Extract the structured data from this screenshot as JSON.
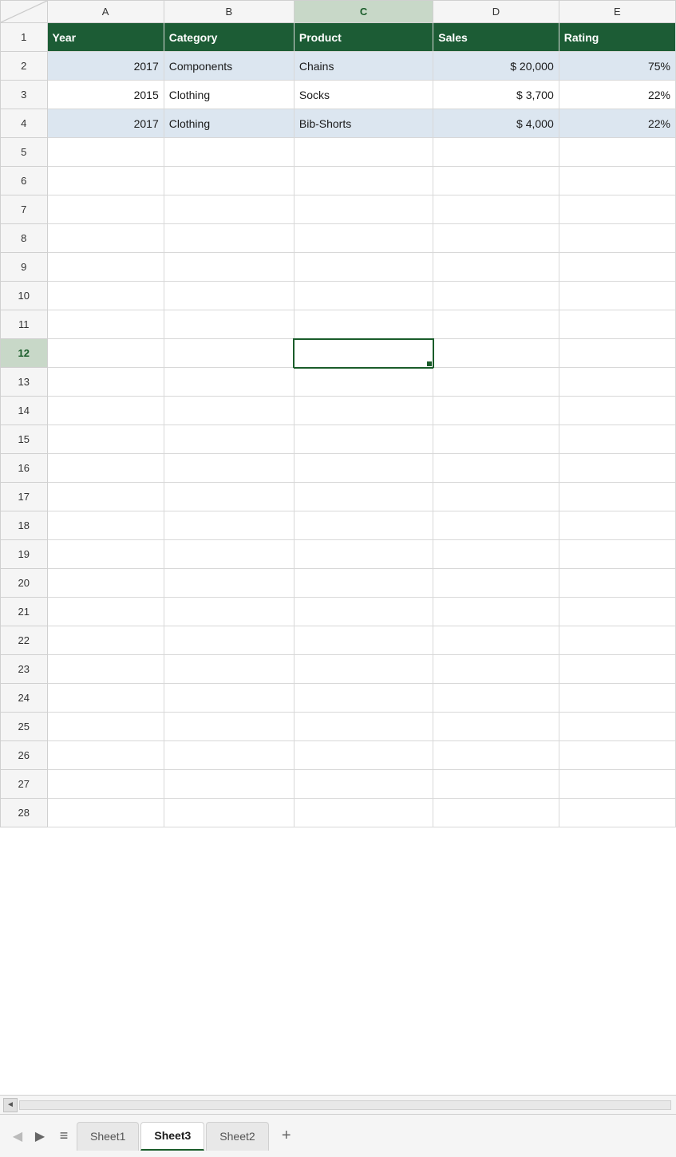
{
  "spreadsheet": {
    "columns": [
      {
        "id": "corner",
        "label": ""
      },
      {
        "id": "A",
        "label": "A"
      },
      {
        "id": "B",
        "label": "B"
      },
      {
        "id": "C",
        "label": "C",
        "selected": true
      },
      {
        "id": "D",
        "label": "D"
      },
      {
        "id": "E",
        "label": "E"
      }
    ],
    "rows": [
      {
        "rowNum": 1,
        "isHeader": true,
        "cells": [
          "Year",
          "Category",
          "Product",
          "Sales",
          "Rating"
        ]
      },
      {
        "rowNum": 2,
        "shade": "even",
        "cells": [
          "2017",
          "Components",
          "Chains",
          "$ 20,000",
          "75%"
        ]
      },
      {
        "rowNum": 3,
        "shade": "odd",
        "cells": [
          "2015",
          "Clothing",
          "Socks",
          "$  3,700",
          "22%"
        ]
      },
      {
        "rowNum": 4,
        "shade": "even",
        "cells": [
          "2017",
          "Clothing",
          "Bib-Shorts",
          "$  4,000",
          "22%"
        ]
      },
      {
        "rowNum": 5,
        "cells": [
          "",
          "",
          "",
          "",
          ""
        ]
      },
      {
        "rowNum": 6,
        "cells": [
          "",
          "",
          "",
          "",
          ""
        ]
      },
      {
        "rowNum": 7,
        "cells": [
          "",
          "",
          "",
          "",
          ""
        ]
      },
      {
        "rowNum": 8,
        "cells": [
          "",
          "",
          "",
          "",
          ""
        ]
      },
      {
        "rowNum": 9,
        "cells": [
          "",
          "",
          "",
          "",
          ""
        ]
      },
      {
        "rowNum": 10,
        "cells": [
          "",
          "",
          "",
          "",
          ""
        ]
      },
      {
        "rowNum": 11,
        "cells": [
          "",
          "",
          "",
          "",
          ""
        ]
      },
      {
        "rowNum": 12,
        "cells": [
          "",
          "",
          "",
          "",
          ""
        ],
        "selectedCol": 2
      },
      {
        "rowNum": 13,
        "cells": [
          "",
          "",
          "",
          "",
          ""
        ]
      },
      {
        "rowNum": 14,
        "cells": [
          "",
          "",
          "",
          "",
          ""
        ]
      },
      {
        "rowNum": 15,
        "cells": [
          "",
          "",
          "",
          "",
          ""
        ]
      },
      {
        "rowNum": 16,
        "cells": [
          "",
          "",
          "",
          "",
          ""
        ]
      },
      {
        "rowNum": 17,
        "cells": [
          "",
          "",
          "",
          "",
          ""
        ]
      },
      {
        "rowNum": 18,
        "cells": [
          "",
          "",
          "",
          "",
          ""
        ]
      },
      {
        "rowNum": 19,
        "cells": [
          "",
          "",
          "",
          "",
          ""
        ]
      },
      {
        "rowNum": 20,
        "cells": [
          "",
          "",
          "",
          "",
          ""
        ]
      },
      {
        "rowNum": 21,
        "cells": [
          "",
          "",
          "",
          "",
          ""
        ]
      },
      {
        "rowNum": 22,
        "cells": [
          "",
          "",
          "",
          "",
          ""
        ]
      },
      {
        "rowNum": 23,
        "cells": [
          "",
          "",
          "",
          "",
          ""
        ]
      },
      {
        "rowNum": 24,
        "cells": [
          "",
          "",
          "",
          "",
          ""
        ]
      },
      {
        "rowNum": 25,
        "cells": [
          "",
          "",
          "",
          "",
          ""
        ]
      },
      {
        "rowNum": 26,
        "cells": [
          "",
          "",
          "",
          "",
          ""
        ]
      },
      {
        "rowNum": 27,
        "cells": [
          "",
          "",
          "",
          "",
          ""
        ]
      },
      {
        "rowNum": 28,
        "cells": [
          "",
          "",
          "",
          "",
          ""
        ]
      }
    ],
    "selectedCell": "C12",
    "activeRow": 12,
    "activeCol": "C"
  },
  "tabs": {
    "prev_disabled_label": "◀",
    "next_label": "▶",
    "menu_label": "≡",
    "add_label": "+",
    "sheets": [
      {
        "name": "Sheet1",
        "active": false
      },
      {
        "name": "Sheet3",
        "active": true
      },
      {
        "name": "Sheet2",
        "active": false
      }
    ]
  },
  "scrollbar": {
    "left_arrow": "◄"
  }
}
